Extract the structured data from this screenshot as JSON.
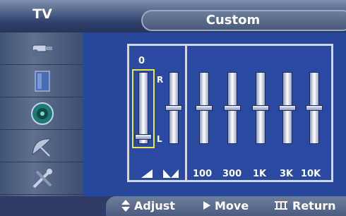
{
  "header": {
    "section_label": "TV",
    "title": "Custom"
  },
  "sidebar": {
    "items": [
      {
        "icon": "connector-plug-icon"
      },
      {
        "icon": "display-screen-icon"
      },
      {
        "icon": "speaker-icon"
      },
      {
        "icon": "satellite-dish-icon"
      },
      {
        "icon": "tools-icon"
      }
    ]
  },
  "equalizer": {
    "balance": {
      "value_label": "0",
      "right_label": "R",
      "left_label": "L",
      "level": 0.05
    },
    "volume_icons": [
      "volume-low-icon",
      "volume-high-icon"
    ],
    "frequencies": [
      {
        "label": "100",
        "level": 0.5
      },
      {
        "label": "300",
        "level": 0.5
      },
      {
        "label": "1K",
        "level": 0.5
      },
      {
        "label": "3K",
        "level": 0.5
      },
      {
        "label": "10K",
        "level": 0.5
      }
    ],
    "balance_extra_level": 0.5
  },
  "help": {
    "adjust": "Adjust",
    "move": "Move",
    "return": "Return"
  },
  "colors": {
    "background": "#27479c",
    "selection": "#e8e84a"
  }
}
